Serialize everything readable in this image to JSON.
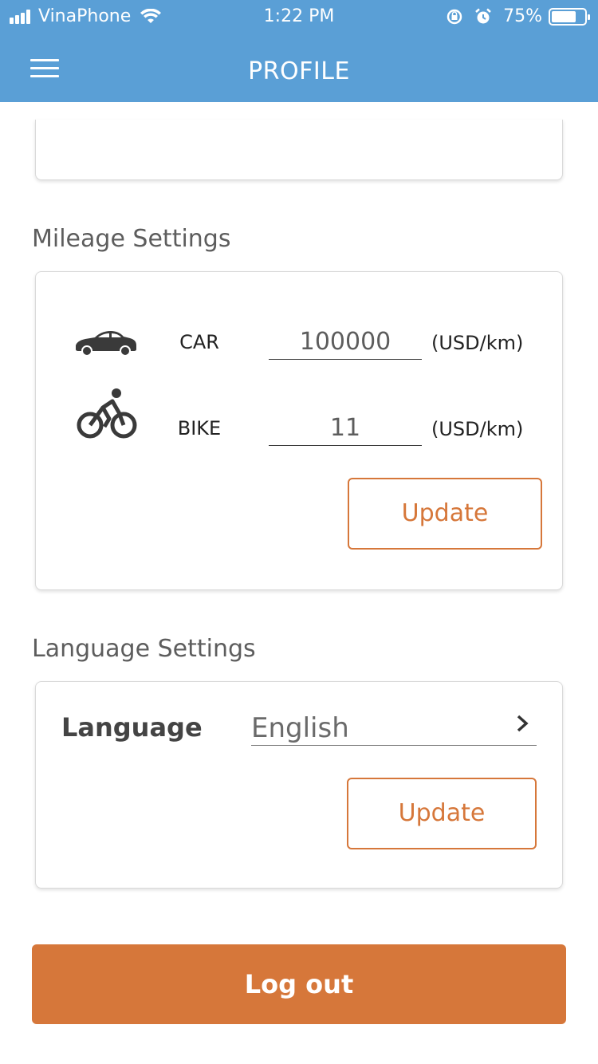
{
  "status_bar": {
    "carrier": "VinaPhone",
    "time": "1:22 PM",
    "battery": "75%",
    "battery_level": 0.75
  },
  "header": {
    "title": "PROFILE",
    "background": "#5a9fd6"
  },
  "mileage": {
    "section_title": "Mileage Settings",
    "rows": [
      {
        "icon": "car-icon",
        "name": "CAR",
        "value": "100000",
        "unit": "(USD/km)"
      },
      {
        "icon": "bike-icon",
        "name": "BIKE",
        "value": "11",
        "unit": "(USD/km)"
      }
    ],
    "update_label": "Update"
  },
  "language": {
    "section_title": "Language Settings",
    "label": "Language",
    "value": "English",
    "update_label": "Update"
  },
  "logout_label": "Log out",
  "accent_color": "#d6773a"
}
